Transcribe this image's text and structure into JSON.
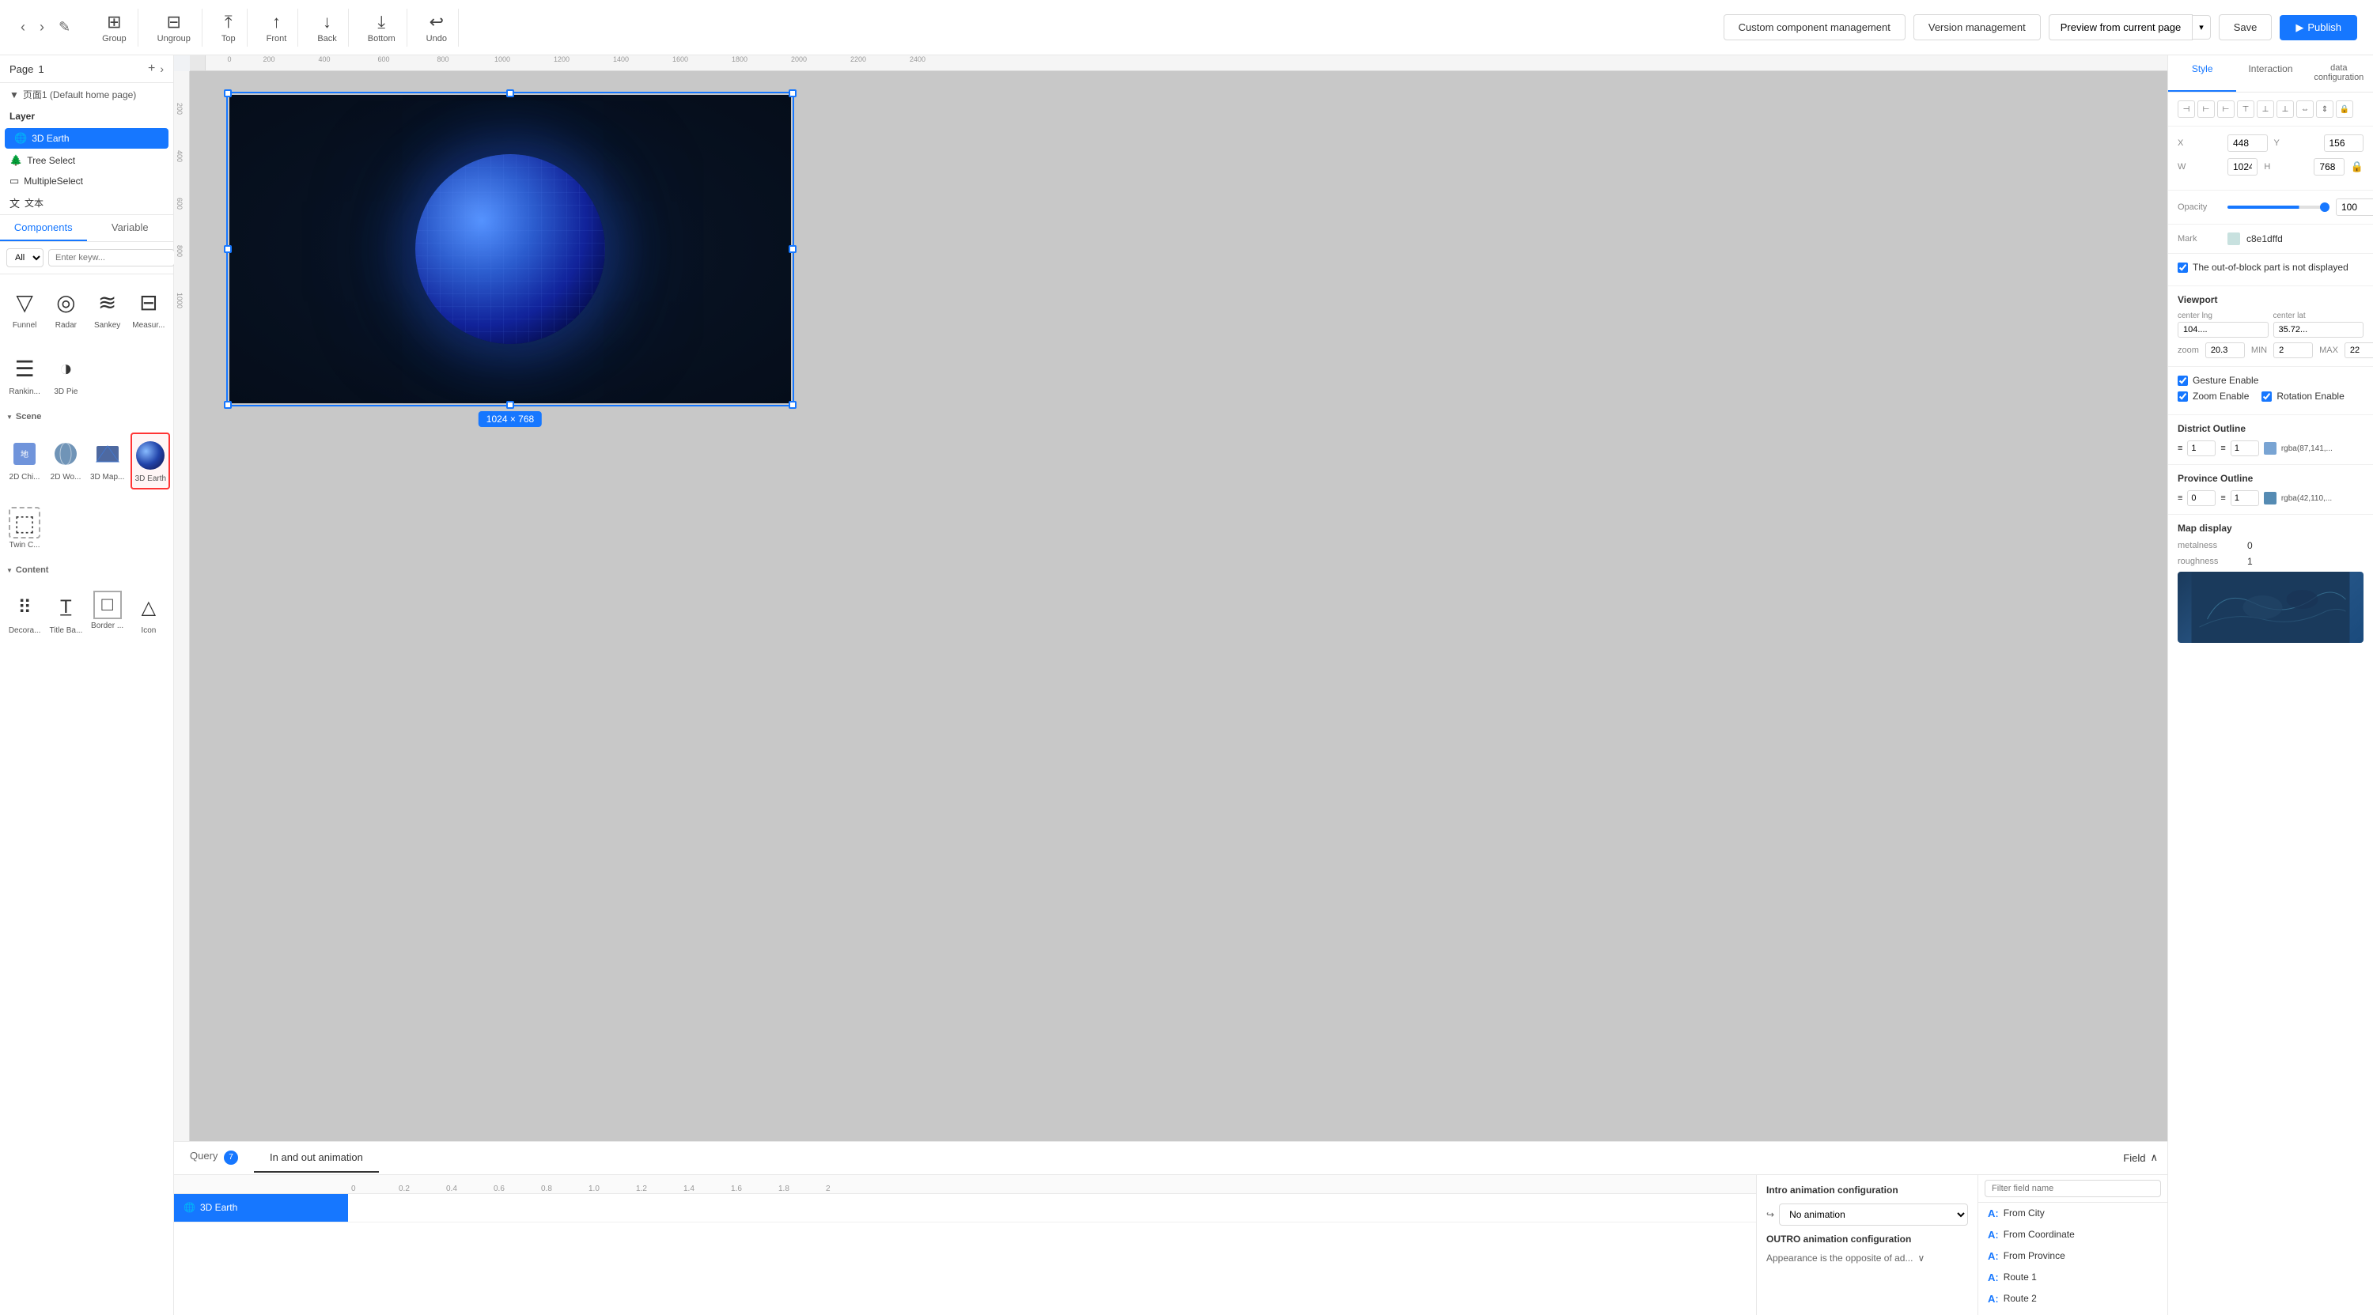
{
  "toolbar": {
    "nav": {
      "back": "‹",
      "forward": "›",
      "edit": "✎"
    },
    "group_label": "Group",
    "ungroup_label": "Ungroup",
    "top_label": "Top",
    "front_label": "Front",
    "back_label": "Back",
    "bottom_label": "Bottom",
    "undo_label": "Undo",
    "custom_component_label": "Custom component management",
    "version_label": "Version management",
    "preview_label": "Preview from current page",
    "save_label": "Save",
    "publish_label": "Publish"
  },
  "left_panel": {
    "page_label": "Page",
    "page_num": "1",
    "page_item": "页面1 (Default home page)",
    "layer_label": "Layer",
    "layers": [
      {
        "icon": "🌐",
        "name": "3D Earth",
        "active": true
      },
      {
        "icon": "🌲",
        "name": "Tree Select",
        "active": false
      },
      {
        "icon": "▭",
        "name": "MultipleSelect",
        "active": false
      },
      {
        "icon": "文",
        "name": "文本",
        "active": false
      }
    ],
    "tabs": [
      "Components",
      "Variable"
    ],
    "active_tab": "Components",
    "search_placeholder": "Enter keyw...",
    "all_label": "All",
    "sections": {
      "scene_label": "Scene",
      "content_label": "Content"
    },
    "scene_components": [
      {
        "id": "2dchi",
        "label": "2D Chi..."
      },
      {
        "id": "2dwo",
        "label": "2D Wo..."
      },
      {
        "id": "3dmap",
        "label": "3D Map..."
      },
      {
        "id": "3dearth",
        "label": "3D Earth",
        "selected": true
      }
    ],
    "content_components": [
      {
        "id": "decora",
        "label": "Decora..."
      },
      {
        "id": "titleba",
        "label": "Title Ba..."
      },
      {
        "id": "border",
        "label": "Border ..."
      },
      {
        "id": "icon",
        "label": "Icon"
      }
    ],
    "top_components": [
      {
        "id": "funnel",
        "label": "Funnel"
      },
      {
        "id": "radar",
        "label": "Radar"
      },
      {
        "id": "sankey",
        "label": "Sankey"
      },
      {
        "id": "measur",
        "label": "Measur..."
      }
    ],
    "mid_components": [
      {
        "id": "ranking",
        "label": "Rankin..."
      },
      {
        "id": "3dpie",
        "label": "3D Pie"
      }
    ],
    "twin_component": {
      "id": "twinc",
      "label": "Twin C..."
    }
  },
  "canvas": {
    "dimension_label": "1024 × 768",
    "element_label": "3D Earth"
  },
  "bottom_panel": {
    "tabs": [
      {
        "label": "Query",
        "badge": "7"
      },
      {
        "label": "In and out animation"
      }
    ],
    "active_tab": "In and out animation",
    "timeline_element": "3D Earth",
    "ruler_marks": [
      "0",
      "0.2",
      "0.4",
      "0.6",
      "0.8",
      "1.0",
      "1.2",
      "1.4",
      "1.6",
      "1.8",
      "2"
    ],
    "animation": {
      "intro_title": "Intro animation configuration",
      "no_animation": "No animation",
      "outro_title": "OUTRO animation configuration",
      "appearance_label": "Appearance is the opposite of ad..."
    },
    "field": {
      "header": "Field",
      "filter_placeholder": "Filter field name",
      "items": [
        {
          "label": "From City"
        },
        {
          "label": "From Coordinate"
        },
        {
          "label": "From Province"
        },
        {
          "label": "Route 1"
        },
        {
          "label": "Route 2"
        }
      ]
    }
  },
  "right_panel": {
    "tabs": [
      "Style",
      "Interaction",
      "data configuration"
    ],
    "active_tab": "Style",
    "position": {
      "x_label": "X",
      "x_value": "448",
      "y_label": "Y",
      "y_value": "156"
    },
    "size": {
      "w_label": "W",
      "w_value": "1024",
      "h_label": "H",
      "h_value": "768"
    },
    "opacity": {
      "label": "Opacity",
      "value": "100",
      "percent": "%"
    },
    "mark": {
      "label": "Mark",
      "value": "c8e1dffd"
    },
    "out_of_block": "The out-of-block part is not displayed",
    "viewport": {
      "title": "Viewport",
      "center_lng_label": "center lng",
      "center_lng_value": "104....",
      "center_lat_label": "center lat",
      "center_lat_value": "35.72...",
      "zoom_label": "zoom",
      "zoom_value": "20.3",
      "min_label": "MIN",
      "min_value": "2",
      "max_label": "MAX",
      "max_value": "22"
    },
    "gesture_enable": "Gesture Enable",
    "zoom_enable": "Zoom Enable",
    "rotation_enable": "Rotation Enable",
    "district_outline": {
      "title": "District Outline",
      "val1": "1",
      "val2": "1",
      "color": "rgba(87,141,..."
    },
    "province_outline": {
      "title": "Province Outline",
      "val1": "0",
      "val2": "1",
      "color": "rgba(42,110,..."
    },
    "map_display": {
      "title": "Map display",
      "metalness_label": "metalness",
      "metalness_value": "0",
      "roughness_label": "roughness",
      "roughness_value": "1"
    }
  },
  "ruler": {
    "horizontal": [
      "0",
      "200",
      "400",
      "600",
      "800",
      "1000",
      "1200",
      "1400",
      "1600",
      "1800",
      "2000",
      "2200",
      "2400"
    ]
  }
}
